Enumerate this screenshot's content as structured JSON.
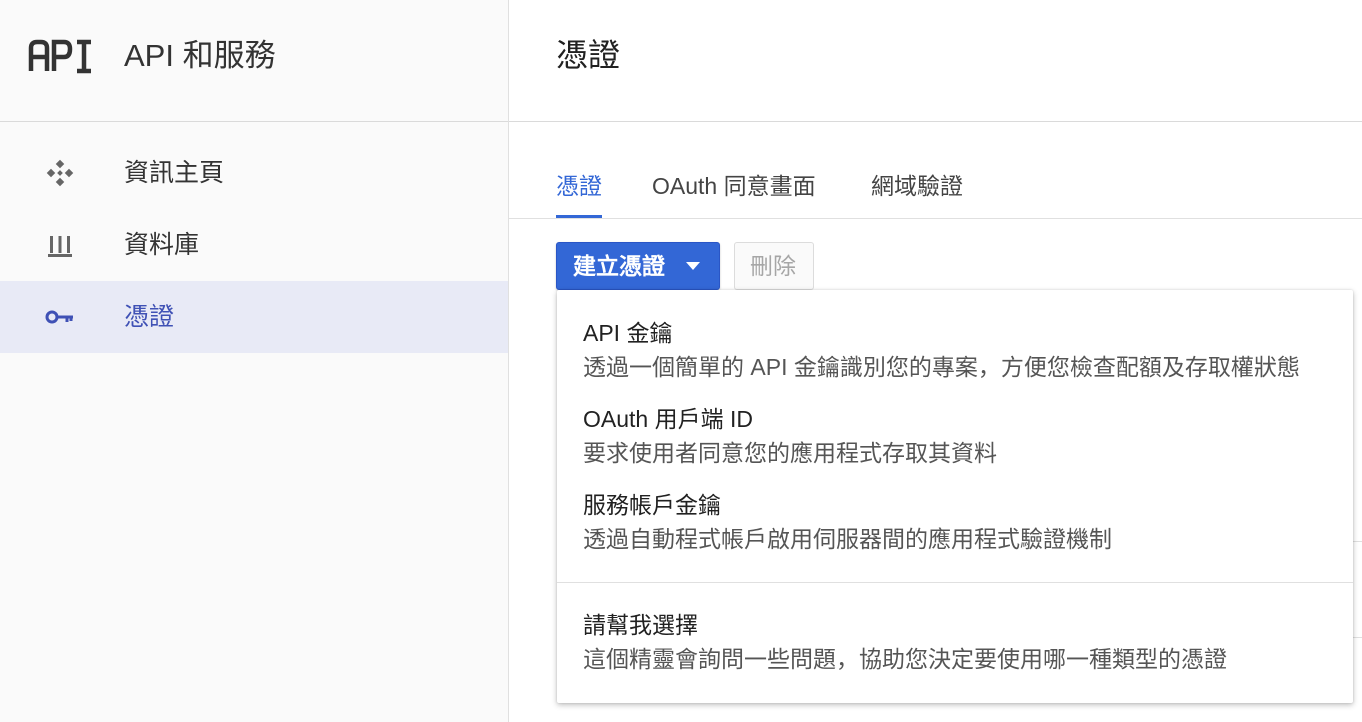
{
  "sidebar": {
    "logo_text": "API",
    "app_title": "API 和服務",
    "items": [
      {
        "label": "資訊主頁",
        "icon": "dashboard-icon"
      },
      {
        "label": "資料庫",
        "icon": "library-icon"
      },
      {
        "label": "憑證",
        "icon": "key-icon",
        "active": true
      }
    ]
  },
  "main": {
    "title": "憑證",
    "tabs": [
      {
        "label": "憑證",
        "active": true
      },
      {
        "label": "OAuth 同意畫面"
      },
      {
        "label": "網域驗證"
      }
    ],
    "toolbar": {
      "create_label": "建立憑證",
      "delete_label": "刪除"
    },
    "menu": {
      "items": [
        {
          "title": "API 金鑰",
          "description": "透過一個簡單的 API 金鑰識別您的專案，方便您檢查配額及存取權狀態"
        },
        {
          "title": "OAuth 用戶端 ID",
          "description": "要求使用者同意您的應用程式存取其資料"
        },
        {
          "title": "服務帳戶金鑰",
          "description": "透過自動程式帳戶啟用伺服器間的應用程式驗證機制"
        },
        {
          "title": "請幫我選擇",
          "description": "這個精靈會詢問一些問題，協助您決定要使用哪一種類型的憑證"
        }
      ]
    }
  },
  "colors": {
    "accent": "#3367d6",
    "active_nav_bg": "#e8eaf6",
    "active_nav_text": "#3f51b5",
    "sidebar_bg": "#fafafa"
  }
}
